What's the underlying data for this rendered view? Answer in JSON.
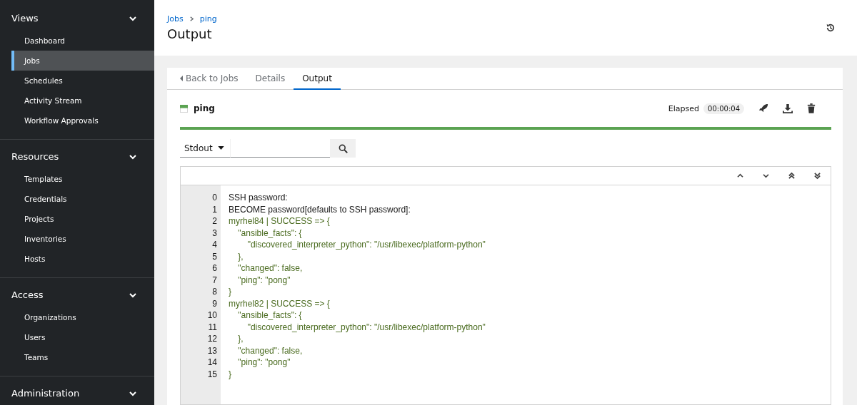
{
  "sidebar": {
    "sections": [
      {
        "title": "Views",
        "expanded": true,
        "items": [
          {
            "label": "Dashboard",
            "selected": false
          },
          {
            "label": "Jobs",
            "selected": true
          },
          {
            "label": "Schedules",
            "selected": false
          },
          {
            "label": "Activity Stream",
            "selected": false
          },
          {
            "label": "Workflow Approvals",
            "selected": false
          }
        ]
      },
      {
        "title": "Resources",
        "expanded": true,
        "items": [
          {
            "label": "Templates",
            "selected": false
          },
          {
            "label": "Credentials",
            "selected": false
          },
          {
            "label": "Projects",
            "selected": false
          },
          {
            "label": "Inventories",
            "selected": false
          },
          {
            "label": "Hosts",
            "selected": false
          }
        ]
      },
      {
        "title": "Access",
        "expanded": true,
        "items": [
          {
            "label": "Organizations",
            "selected": false
          },
          {
            "label": "Users",
            "selected": false
          },
          {
            "label": "Teams",
            "selected": false
          }
        ]
      },
      {
        "title": "Administration",
        "expanded": true
      }
    ]
  },
  "breadcrumb": [
    "Jobs",
    "ping"
  ],
  "page_title": "Output",
  "tabs": [
    {
      "label": "Back to Jobs",
      "kind": "back",
      "selected": false
    },
    {
      "label": "Details",
      "kind": "tab",
      "selected": false
    },
    {
      "label": "Output",
      "kind": "tab",
      "selected": true
    }
  ],
  "job": {
    "name": "ping",
    "successful": true,
    "elapsed_label": "Elapsed",
    "elapsed": "00:00:04"
  },
  "filter": {
    "selected": "Stdout"
  },
  "output_lines": [
    {
      "number": "0",
      "text": "SSH password:",
      "kind": "plain"
    },
    {
      "number": "1",
      "text": "BECOME password[defaults to SSH password]:",
      "kind": "plain"
    },
    {
      "number": "2",
      "text": "myrhel84 | SUCCESS => {",
      "kind": "ok"
    },
    {
      "number": "3",
      "text": "    \"ansible_facts\": {",
      "kind": "ok"
    },
    {
      "number": "4",
      "text": "        \"discovered_interpreter_python\": \"/usr/libexec/platform-python\"",
      "kind": "ok"
    },
    {
      "number": "5",
      "text": "    },",
      "kind": "ok"
    },
    {
      "number": "6",
      "text": "    \"changed\": false,",
      "kind": "ok"
    },
    {
      "number": "7",
      "text": "    \"ping\": \"pong\"",
      "kind": "ok"
    },
    {
      "number": "8",
      "text": "}",
      "kind": "ok"
    },
    {
      "number": "9",
      "text": "myrhel82 | SUCCESS => {",
      "kind": "ok"
    },
    {
      "number": "10",
      "text": "    \"ansible_facts\": {",
      "kind": "ok"
    },
    {
      "number": "11",
      "text": "        \"discovered_interpreter_python\": \"/usr/libexec/platform-python\"",
      "kind": "ok"
    },
    {
      "number": "12",
      "text": "    },",
      "kind": "ok"
    },
    {
      "number": "13",
      "text": "    \"changed\": false,",
      "kind": "ok"
    },
    {
      "number": "14",
      "text": "    \"ping\": \"pong\"",
      "kind": "ok"
    },
    {
      "number": "15",
      "text": "}",
      "kind": "ok"
    }
  ]
}
